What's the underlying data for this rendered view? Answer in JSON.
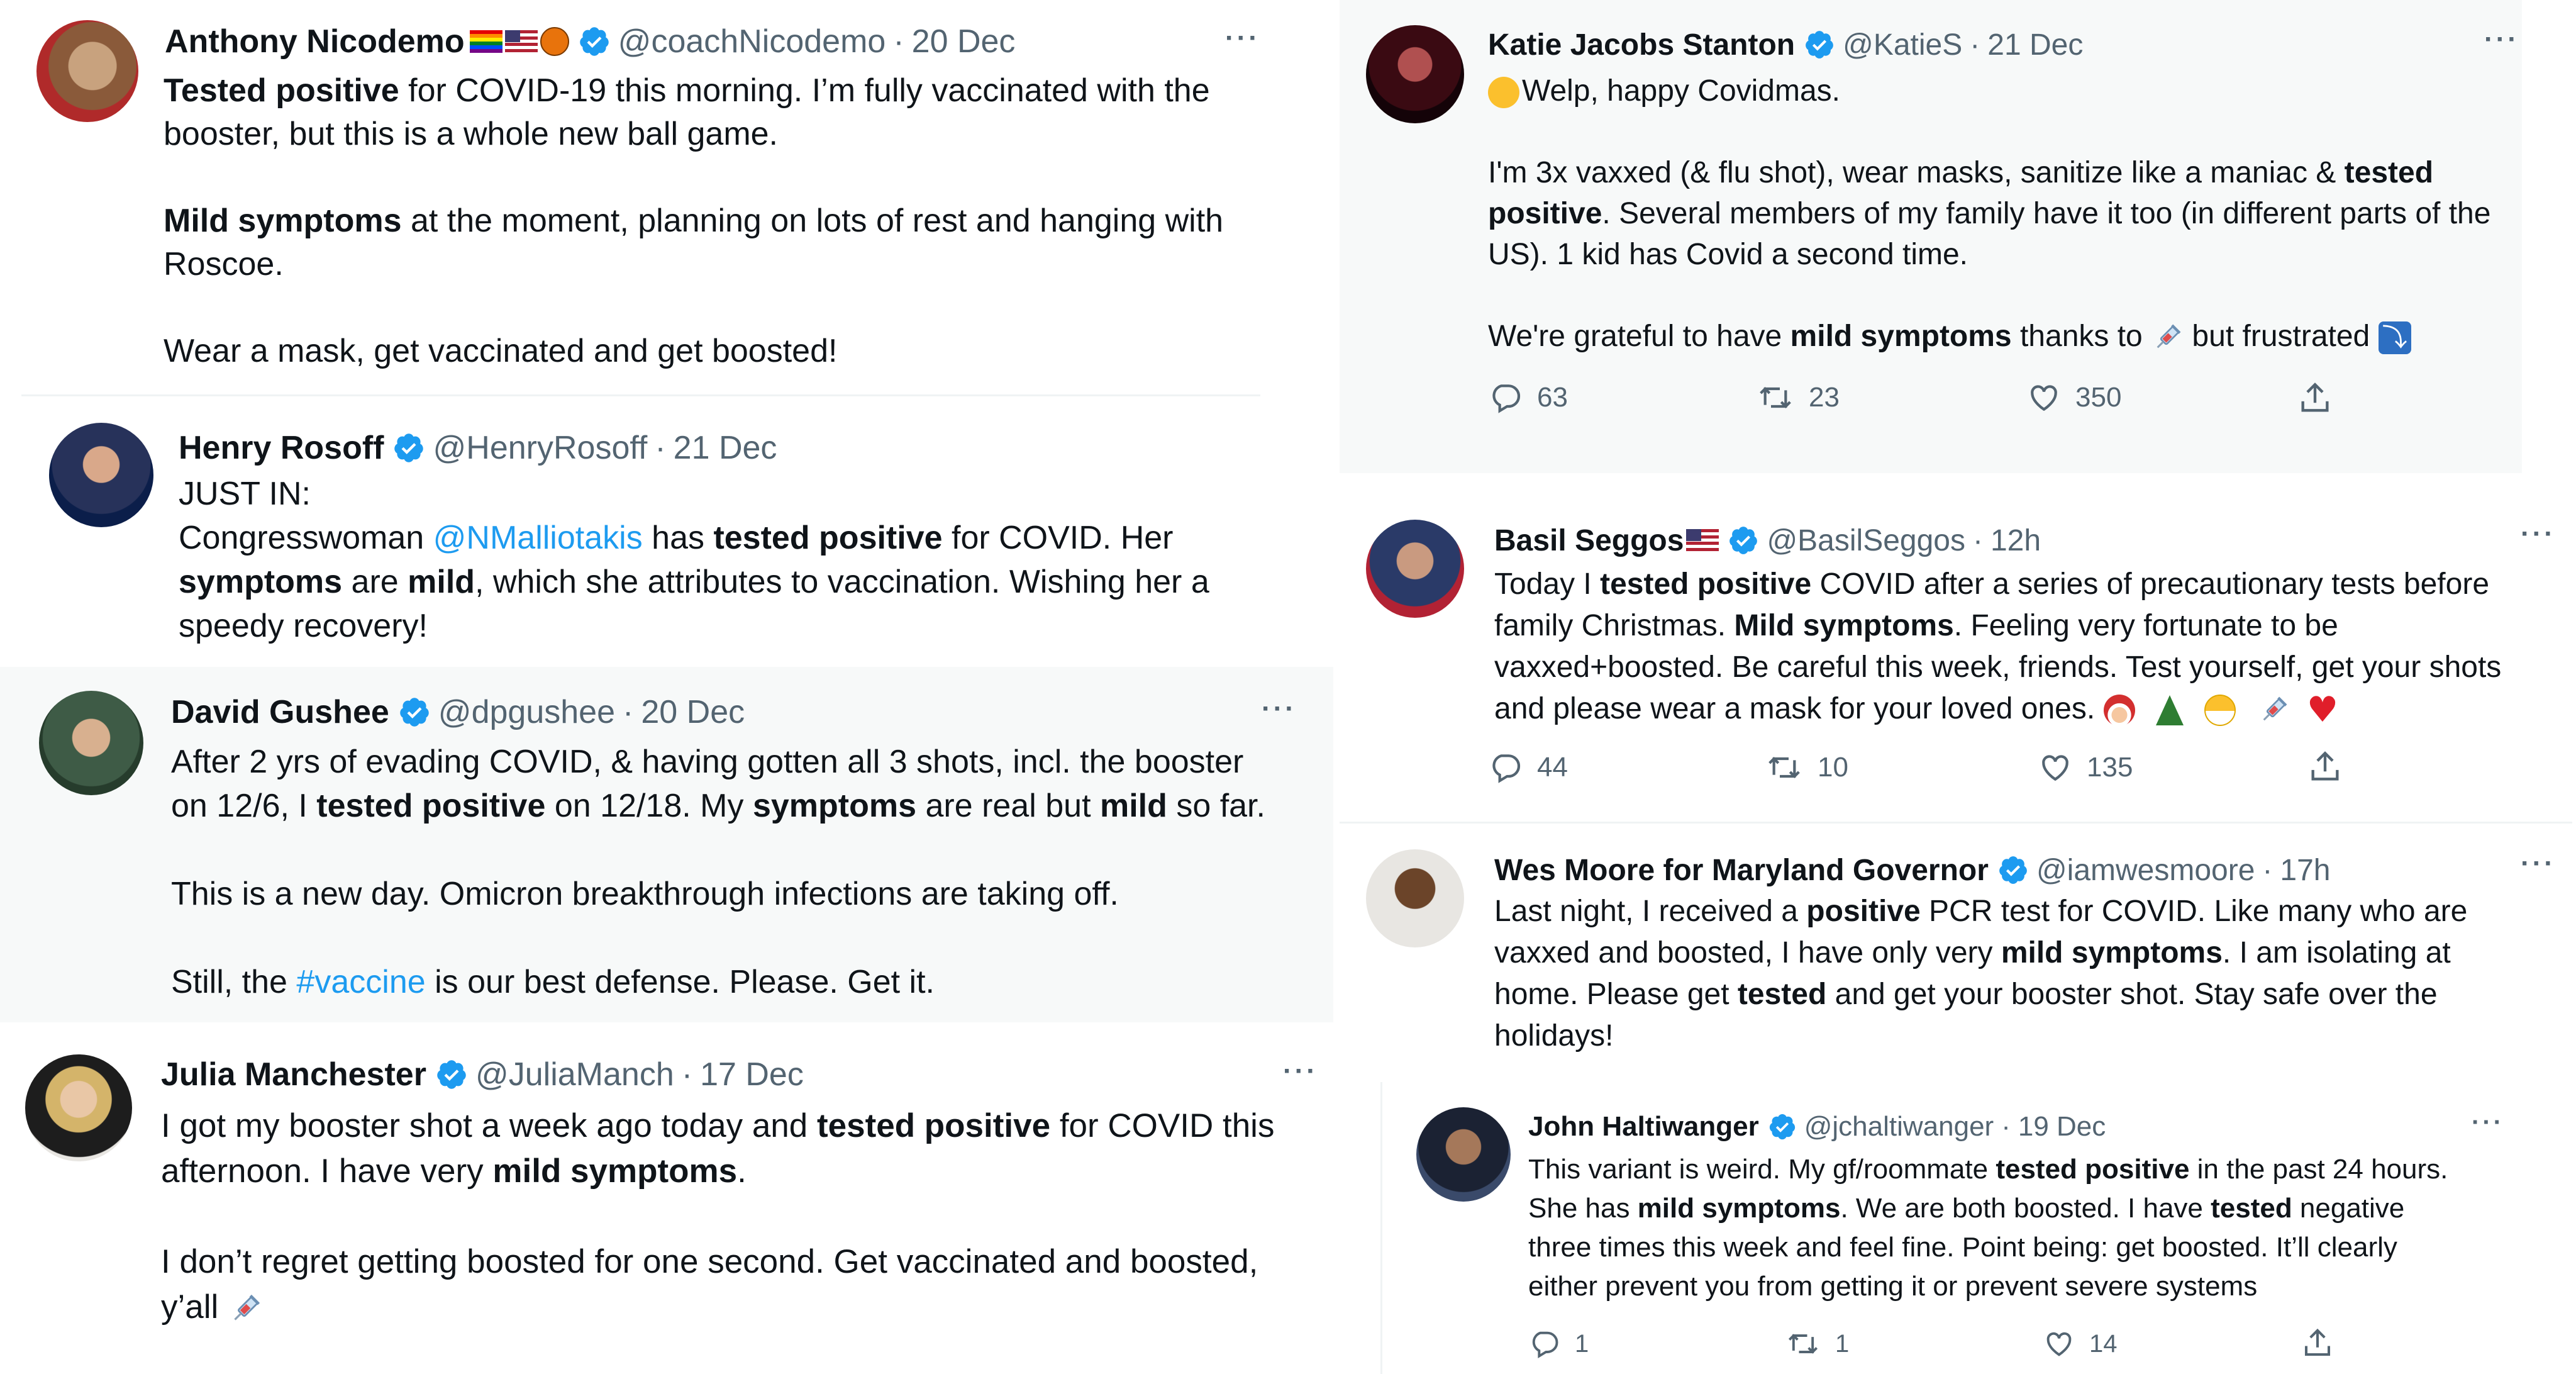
{
  "tweets": {
    "anthony": {
      "name": "Anthony Nicodemo",
      "handle": "@coachNicodemo",
      "sep": "·",
      "date": "20 Dec",
      "more": "···",
      "l1a": "Tested positive",
      "l1b": " for COVID-19 this morning. I’m fully vaccinated with the",
      "l2": "booster, but this is a whole new ball game.",
      "l3a": "Mild symptoms",
      "l3b": " at the moment, planning on lots of rest and hanging with",
      "l4": "Roscoe.",
      "l5": "Wear a mask, get vaccinated and get boosted!"
    },
    "henry": {
      "name": "Henry Rosoff",
      "handle": "@HenryRosoff",
      "sep": "·",
      "date": "21 Dec",
      "l1": "JUST IN:",
      "l2a": "Congresswoman ",
      "l2b": "@NMalliotakis",
      "l2c": " has ",
      "l2d": "tested positive",
      "l2e": " for COVID.  Her",
      "l3a": "symptoms",
      "l3b": " are ",
      "l3c": "mild",
      "l3d": ", which she attributes to vaccination.  Wishing her a",
      "l4": "speedy recovery!"
    },
    "david": {
      "name": "David Gushee",
      "handle": "@dpgushee",
      "sep": "·",
      "date": "20 Dec",
      "more": "···",
      "l1": "After 2 yrs of evading COVID, & having gotten all 3 shots, incl. the booster",
      "l2a": "on 12/6, I ",
      "l2b": "tested positive",
      "l2c": " on 12/18. My ",
      "l2d": "symptoms",
      "l2e": " are real but ",
      "l2f": "mild",
      "l2g": " so far.",
      "l3": "This is a new day. Omicron breakthrough infections are taking off.",
      "l4a": "Still, the ",
      "l4b": "#vaccine",
      "l4c": " is our best defense. Please. Get it."
    },
    "julia": {
      "name": "Julia Manchester",
      "handle": "@JuliaManch",
      "sep": "·",
      "date": "17 Dec",
      "more": "···",
      "l1a": "I got my booster shot a week ago today and ",
      "l1b": "tested positive",
      "l1c": " for COVID this",
      "l2a": "afternoon. I have very ",
      "l2b": "mild symptoms",
      "l2c": ".",
      "l3": "I don’t regret getting boosted for one second. Get vaccinated and boosted,",
      "l4": "y’all"
    },
    "katie": {
      "name": "Katie Jacobs Stanton",
      "handle": "@KatieS",
      "sep": "·",
      "date": "21 Dec",
      "more": "···",
      "l1": "Welp, happy Covidmas.",
      "l2a": "I'm 3x vaxxed (& flu shot), wear masks, sanitize like a maniac & ",
      "l2b": "tested",
      "l3a": "positive",
      "l3b": ". Several members of my family have it too (in different parts of the",
      "l4": "US). 1 kid has Covid a second time.",
      "l5a": "We're grateful to have ",
      "l5b": "mild symptoms",
      "l5c": " thanks to ",
      "l5d": " but frustrated ",
      "replies": "63",
      "retweets": "23",
      "likes": "350"
    },
    "basil": {
      "name": "Basil Seggos",
      "handle": "@BasilSeggos",
      "sep": "·",
      "date": "12h",
      "more": "···",
      "l1a": "Today I ",
      "l1b": "tested positive",
      "l1c": " COVID after a series of precautionary tests before",
      "l2a": "family Christmas. ",
      "l2b": "Mild symptoms",
      "l2c": ". Feeling very fortunate to be",
      "l3": "vaxxed+boosted. Be careful this week, friends. Test yourself, get your shots",
      "l4": "and please wear a mask for your loved ones. ",
      "replies": "44",
      "retweets": "10",
      "likes": "135"
    },
    "wes": {
      "name": "Wes Moore for Maryland Governor",
      "handle": "@iamwesmoore",
      "sep": "·",
      "date": "17h",
      "more": "···",
      "l1a": "Last night, I received a ",
      "l1b": "positive",
      "l1c": " PCR test for COVID. Like many who are",
      "l2a": "vaxxed and boosted, I have only very ",
      "l2b": "mild symptoms",
      "l2c": ". I am isolating at",
      "l3a": "home. Please get ",
      "l3b": "tested",
      "l3c": " and get your booster shot. Stay safe over the",
      "l4": "holidays!"
    },
    "john": {
      "name": "John Haltiwanger",
      "handle": "@jchaltiwanger",
      "sep": "·",
      "date": "19 Dec",
      "more": "···",
      "l1a": "This variant is weird. My gf/roommate ",
      "l1b": "tested positive",
      "l1c": " in the past 24 hours.",
      "l2a": "She has ",
      "l2b": "mild symptoms",
      "l2c": ". We are both boosted. I have ",
      "l2d": "tested",
      "l2e": " negative",
      "l3": "three times this week and feel fine. Point being: get boosted. It’ll clearly",
      "l4": "either prevent you from getting it or prevent severe systems",
      "replies": "1",
      "retweets": "1",
      "likes": "14"
    }
  },
  "colors": {
    "verified": "#1d9bf0",
    "muted": "#536471",
    "link": "#1d9bf0",
    "panel": "#f7f9f9"
  },
  "icons": [
    "verified-badge-icon",
    "reply-icon",
    "retweet-icon",
    "like-icon",
    "share-icon",
    "syringe-icon",
    "face-screaming-icon",
    "santa-icon",
    "christmas-tree-icon",
    "mask-face-icon",
    "heart-icon",
    "arrow-down-icon",
    "flag-icon",
    "basketball-icon"
  ]
}
